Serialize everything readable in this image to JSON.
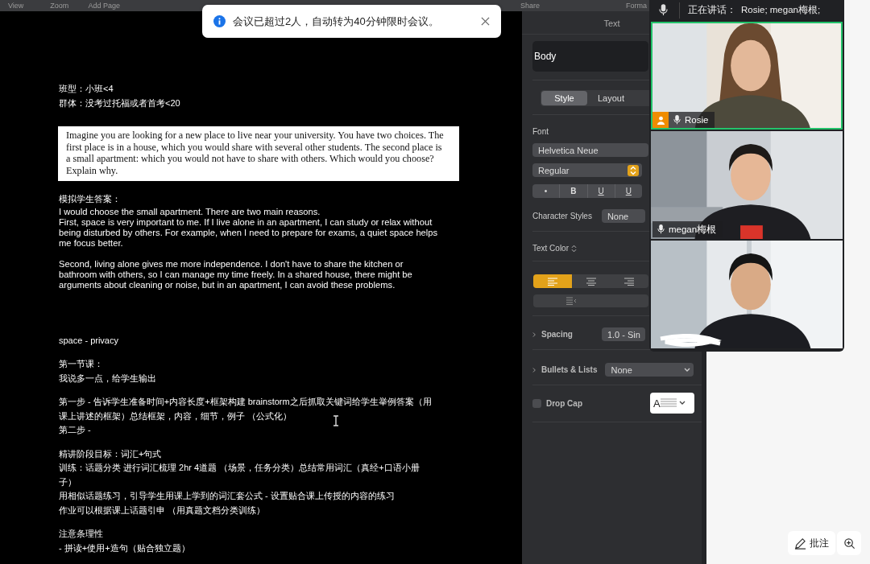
{
  "toolbar": {
    "items": [
      "View",
      "Zoom",
      "Add Page",
      "Share",
      "Forma"
    ]
  },
  "toast": {
    "message": "会议已超过2人，自动转为40分钟限时会议。"
  },
  "document": {
    "blocks": [
      {
        "kind": "lines",
        "lines": [
          "班型：小班<4",
          "群体：没考过托福或者首考<20"
        ]
      },
      {
        "kind": "question",
        "lines": [
          "Imagine you are looking for a new place to live near your university. You have two choices. The",
          "first place is in a house, which you would share with several other students. The second place is",
          "a small apartment: which you would not have to share with others. Which would you choose?",
          "Explain why."
        ]
      },
      {
        "kind": "answer",
        "heading": "模拟学生答案：",
        "paragraphs": [
          [
            "I would choose the small apartment. There are two main reasons.",
            "First, space is very important to me. If I live alone in an apartment, I can study or relax without",
            "being disturbed by others. For example, when I need to prepare for exams, a quiet space helps",
            "me focus better."
          ],
          [
            "Second, living alone gives me more independence. I don't have to share the kitchen or",
            "bathroom with others, so I can manage my time freely. In a shared house, there might be",
            "arguments about cleaning or noise, but in an apartment, I can avoid these problems."
          ]
        ]
      },
      {
        "kind": "lines",
        "lines": [
          "space - privacy"
        ]
      },
      {
        "kind": "lines",
        "lines": [
          "第一节课：",
          "我说多一点，给学生输出"
        ]
      },
      {
        "kind": "lines",
        "lines": [
          "第一步 - 告诉学生准备时间+内容长度+框架构建 brainstorm之后抓取关键词给学生举例答案（用",
          "课上讲述的框架）总结框架，内容，细节，例子 （公式化）",
          "第二步 -"
        ]
      },
      {
        "kind": "lines",
        "lines": [
          "精讲阶段目标：词汇+句式",
          "训练：话题分类 进行词汇梳理 2hr 4道题 （场景，任务分类）总结常用词汇（真经+口语小册",
          "子）",
          "用相似话题练习，引导学生用课上学到的词汇套公式 - 设置贴合课上传授的内容的练习",
          "作业可以根据课上话题引申 （用真题文档分类训练）"
        ]
      },
      {
        "kind": "lines",
        "lines": [
          "注意条理性",
          "- 拼读+使用+造句（贴合独立题）"
        ]
      }
    ]
  },
  "inspector": {
    "title": "Text",
    "paragraph_style": "Body",
    "tabs": [
      {
        "label": "Style",
        "selected": true
      },
      {
        "label": "Layout",
        "selected": false
      }
    ],
    "font_label": "Font",
    "font_family": "Helvetica Neue",
    "typeface": "Regular",
    "format_buttons": [
      {
        "kind": "bullet",
        "label": "•"
      },
      {
        "kind": "bold",
        "label": "B"
      },
      {
        "kind": "underline",
        "label": "U"
      },
      {
        "kind": "underline",
        "label": "U"
      }
    ],
    "character_styles": {
      "label": "Character Styles",
      "value": "None"
    },
    "text_color_label": "Text Color",
    "alignment": [
      {
        "kind": "left",
        "selected": true
      },
      {
        "kind": "center",
        "selected": false
      },
      {
        "kind": "right",
        "selected": false
      }
    ],
    "spacing": {
      "label": "Spacing",
      "value": "1.0 - Sin"
    },
    "bullets": {
      "label": "Bullets & Lists",
      "value": "None"
    },
    "drop_cap": {
      "label": "Drop Cap",
      "checked": false,
      "preview": "A"
    }
  },
  "meeting": {
    "speaking_label": "正在讲话：",
    "speakers": "Rosie; megan梅根;",
    "participants": [
      {
        "name": "Rosie",
        "active_speaker": true,
        "host": true
      },
      {
        "name": "megan梅根",
        "active_speaker": false,
        "host": false
      },
      {
        "name_hidden": true,
        "active_speaker": false,
        "host": false
      }
    ]
  },
  "annotate_button": {
    "label": "批注"
  }
}
